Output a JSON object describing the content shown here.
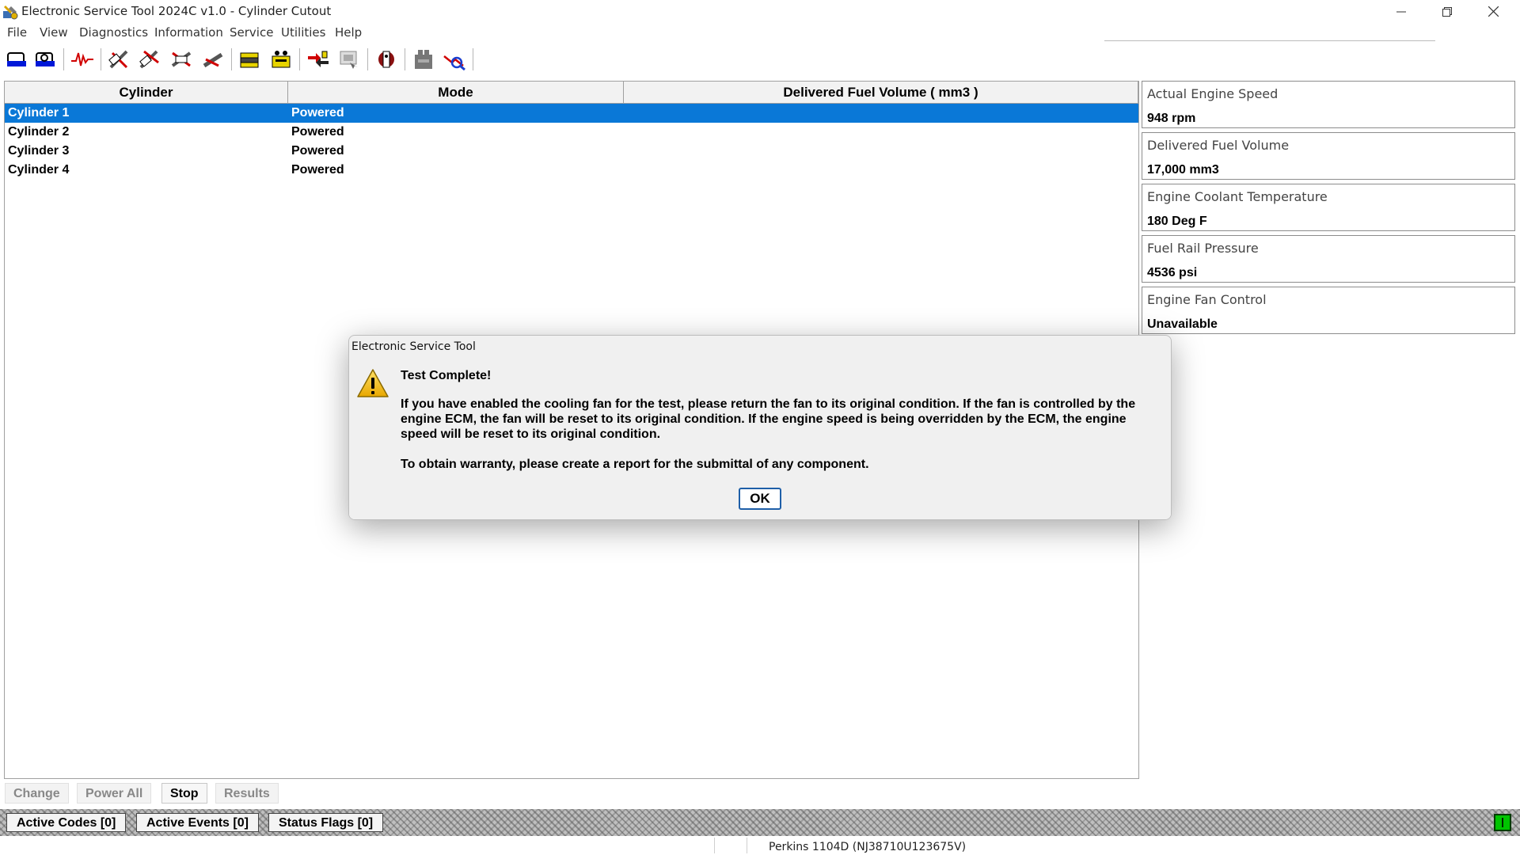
{
  "window": {
    "title": "Electronic Service Tool 2024C v1.0 - Cylinder Cutout",
    "controls": [
      "minimize-icon",
      "restore-icon",
      "close-icon"
    ]
  },
  "menu": [
    "File",
    "View",
    "Diagnostics",
    "Information",
    "Service",
    "Utilities",
    "Help"
  ],
  "table": {
    "headers": [
      "Cylinder",
      "Mode",
      "Delivered Fuel Volume ( mm3 )"
    ],
    "rows": [
      {
        "cylinder": "Cylinder 1",
        "mode": "Powered",
        "fuel": "",
        "selected": true
      },
      {
        "cylinder": "Cylinder 2",
        "mode": "Powered",
        "fuel": ""
      },
      {
        "cylinder": "Cylinder 3",
        "mode": "Powered",
        "fuel": ""
      },
      {
        "cylinder": "Cylinder 4",
        "mode": "Powered",
        "fuel": ""
      }
    ]
  },
  "params": [
    {
      "label": "Actual Engine Speed",
      "value": "948 rpm"
    },
    {
      "label": "Delivered Fuel Volume",
      "value": "17,000 mm3"
    },
    {
      "label": "Engine Coolant Temperature",
      "value": "180 Deg F"
    },
    {
      "label": "Fuel Rail Pressure",
      "value": "4536 psi"
    },
    {
      "label": "Engine Fan Control",
      "value": "Unavailable"
    }
  ],
  "actions": {
    "change": "Change",
    "power_all": "Power All",
    "stop": "Stop",
    "results": "Results"
  },
  "status": {
    "active_codes": "Active Codes [0]",
    "active_events": "Active Events [0]",
    "status_flags": "Status Flags [0]",
    "led_color": "#00c400"
  },
  "footer": {
    "ecm": "Perkins 1104D (NJ38710U123675V)"
  },
  "dialog": {
    "title": "Electronic Service Tool",
    "heading": "Test Complete!",
    "message1": "If you have enabled the cooling fan for the test, please return the fan to its original condition. If the fan is controlled by the engine ECM, the fan will be reset to its original condition. If the engine speed is being overridden by the ECM, the engine speed will be reset to its original condition.",
    "message2": "To obtain warranty, please create a report for the submittal of any component.",
    "ok": "OK",
    "icon": "warning-icon"
  },
  "colors": {
    "selection": "#0a78d7",
    "ok_border": "#1e5fa8"
  }
}
